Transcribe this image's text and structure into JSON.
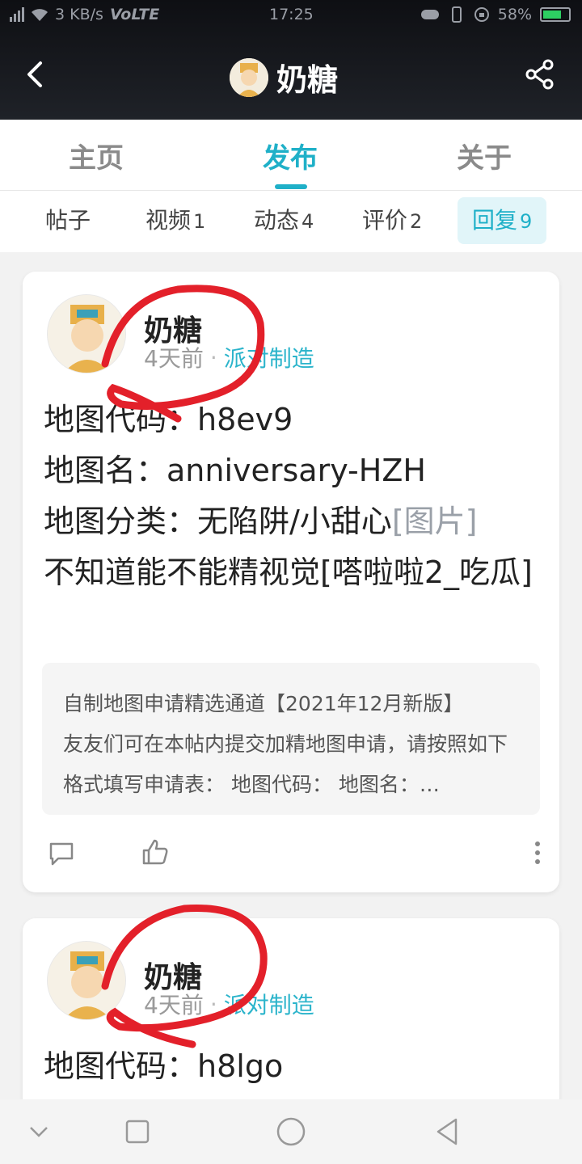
{
  "status_bar": {
    "network": "3 KB/s",
    "volte": "VoLTE",
    "time": "17:25",
    "battery": "58%"
  },
  "header": {
    "title": "奶糖"
  },
  "tabs": [
    {
      "label": "主页"
    },
    {
      "label": "发布"
    },
    {
      "label": "关于"
    }
  ],
  "subtabs": [
    {
      "label": "帖子",
      "count": ""
    },
    {
      "label": "视频",
      "count": "1"
    },
    {
      "label": "动态",
      "count": "4"
    },
    {
      "label": "评价",
      "count": "2"
    },
    {
      "label": "回复",
      "count": "9"
    }
  ],
  "posts": [
    {
      "username": "奶糖",
      "time": "4天前",
      "separator": "·",
      "tag": "派对制造",
      "lines": [
        "地图代码：h8ev9",
        "地图名：anniversary-HZH",
        "地图分类：无陷阱/小甜心",
        "[图片]",
        "不知道能不能精视觉[嗒啦啦2_吃瓜]"
      ],
      "quote_title": "自制地图申请精选通道【2021年12月新版】",
      "quote_body": "友友们可在本帖内提交加精地图申请，请按照如下格式填写申请表： 地图代码： 地图名：…"
    },
    {
      "username": "奶糖",
      "time": "4天前",
      "separator": "·",
      "tag": "派对制造",
      "lines": [
        "地图代码：h8lgo"
      ]
    }
  ],
  "colors": {
    "accent": "#1fb0c8",
    "scribble": "#e3202a",
    "header_bg": "#15171c"
  }
}
